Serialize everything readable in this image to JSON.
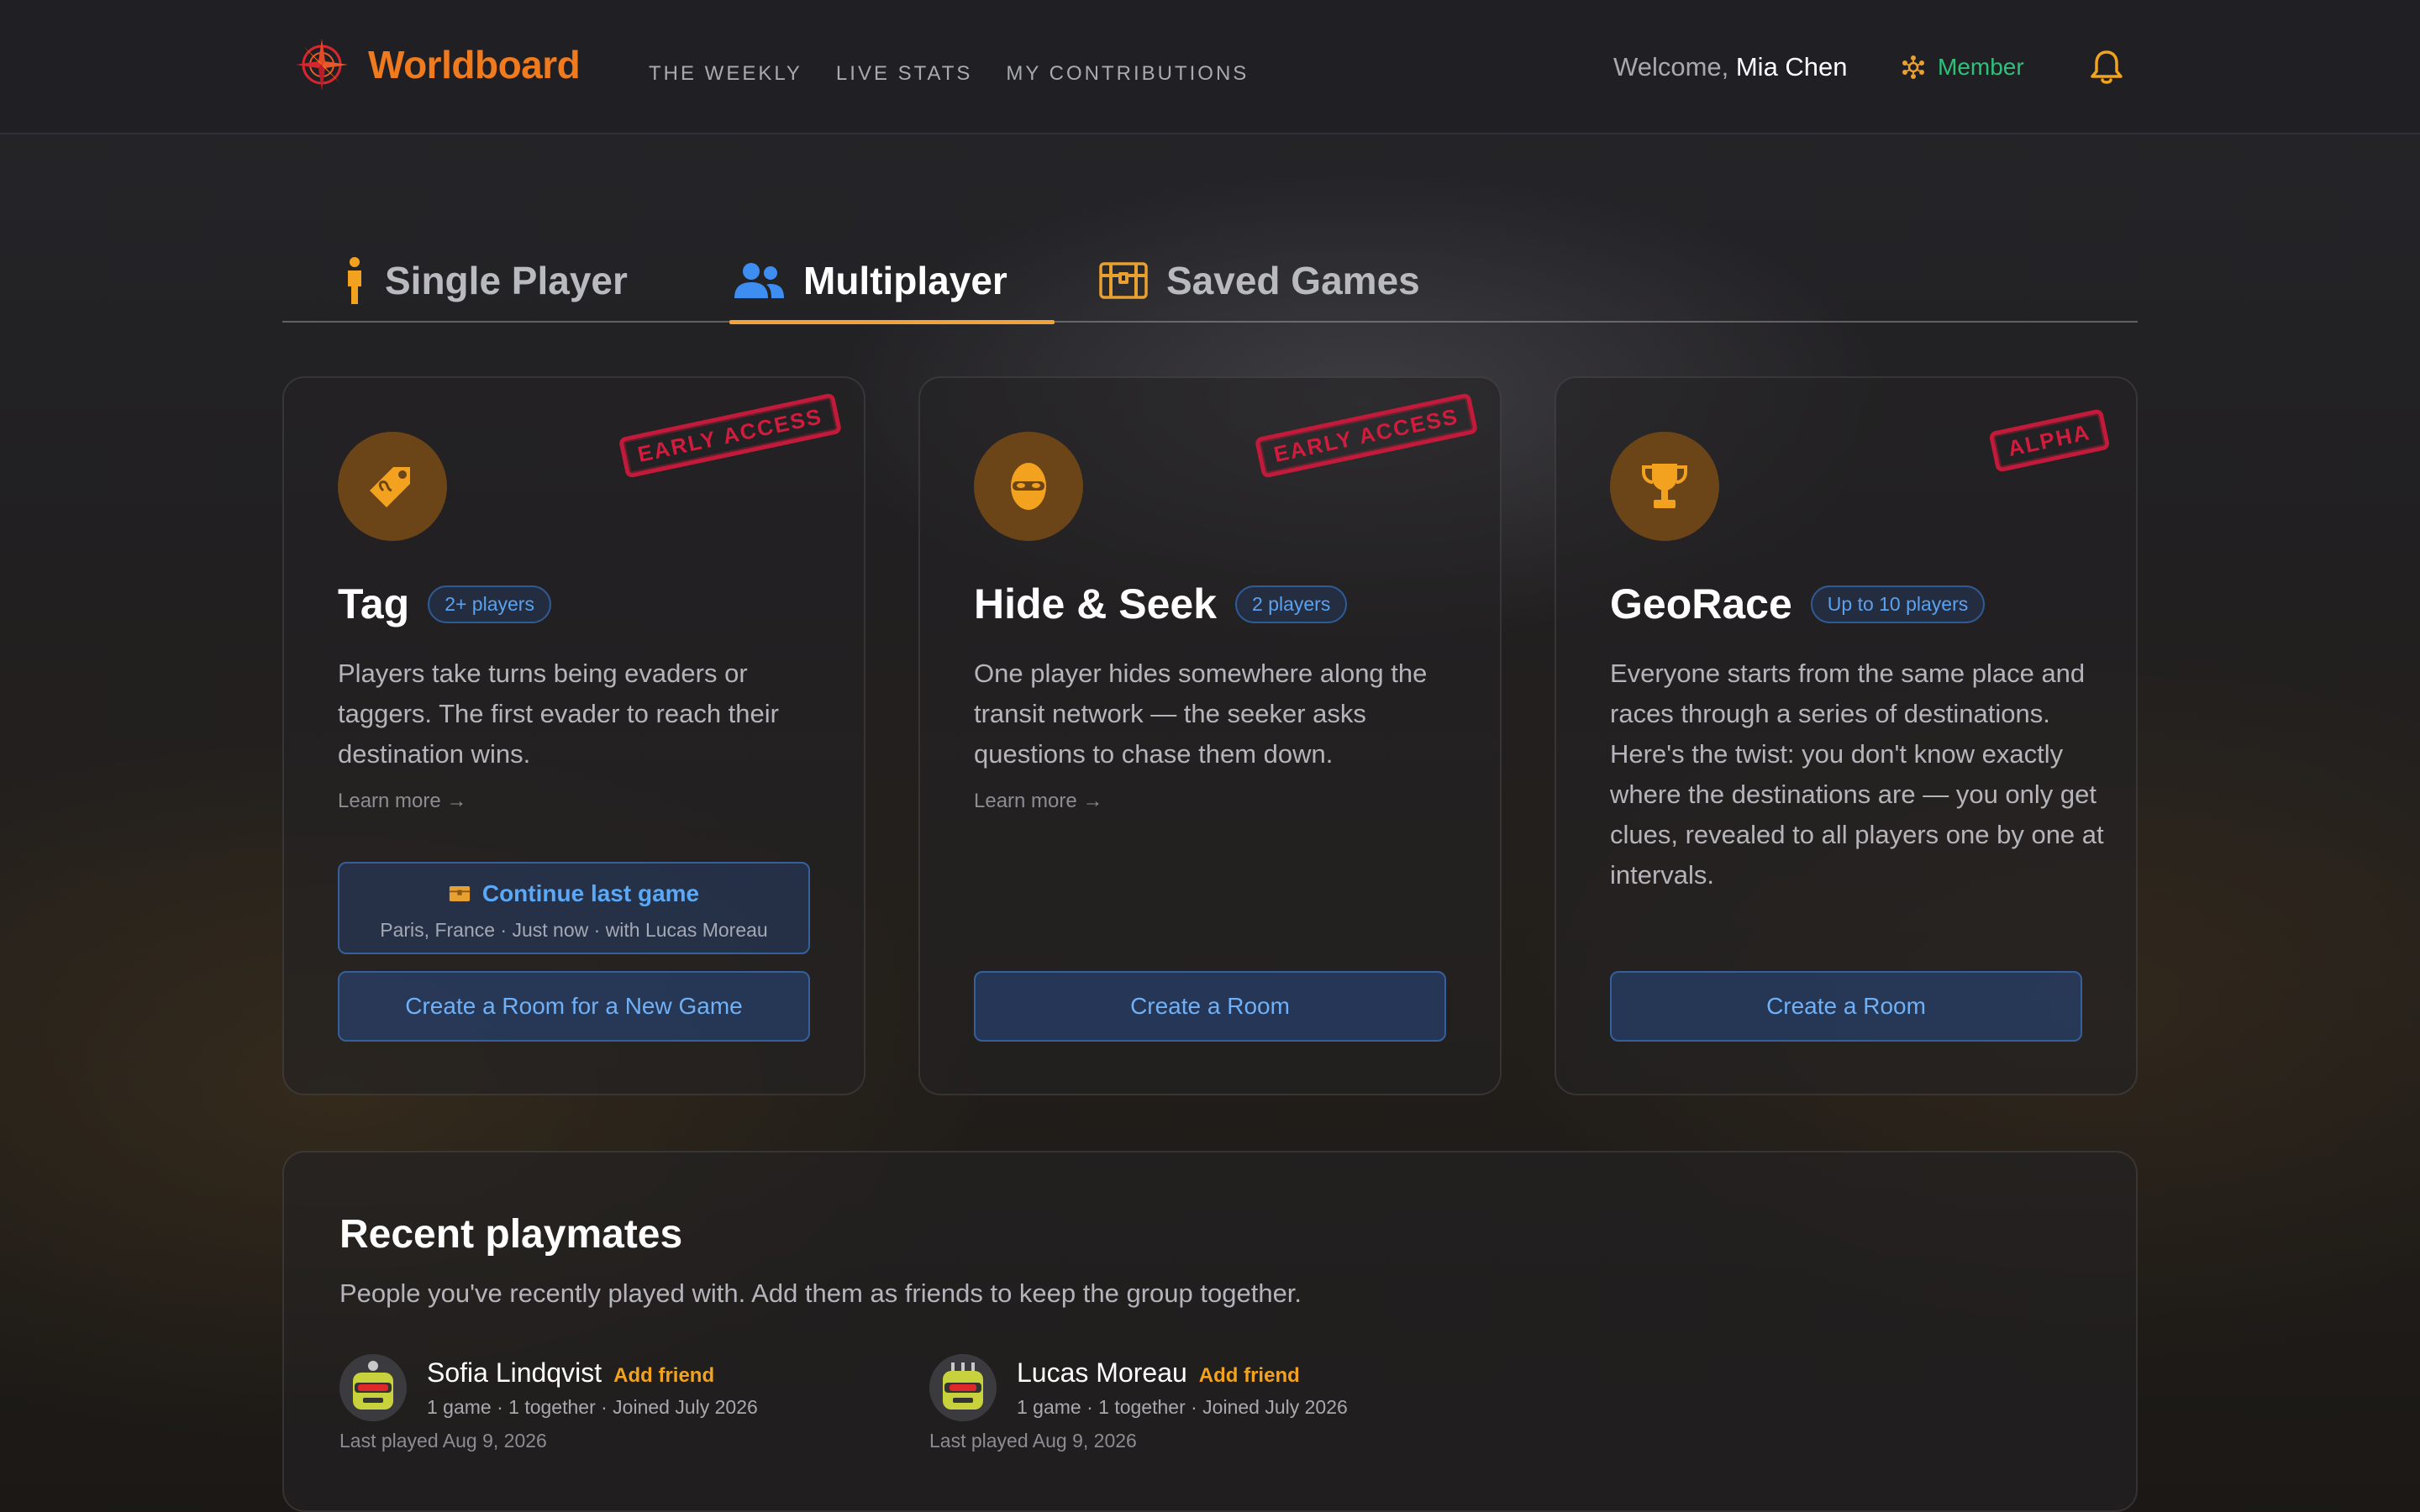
{
  "header": {
    "logo_text": "Worldboard",
    "nav": [
      "THE WEEKLY",
      "LIVE STATS",
      "MY CONTRIBUTIONS"
    ],
    "welcome_prefix": "Welcome, ",
    "user_name": "Mia Chen",
    "member_label": "Member"
  },
  "tabs": [
    {
      "label": "Single Player",
      "icon": "person-icon",
      "active": false
    },
    {
      "label": "Multiplayer",
      "icon": "users-icon",
      "active": true
    },
    {
      "label": "Saved Games",
      "icon": "treasure-chest-icon",
      "active": false
    }
  ],
  "cards": [
    {
      "icon": "tag-icon",
      "stamp": "EARLY ACCESS",
      "title": "Tag",
      "badge": "2+ players",
      "description": "Players take turns being evaders or taggers. The first evader to reach their destination wins.",
      "learn_more": "Learn more →",
      "continue_label": "Continue last game",
      "continue_sub": "Paris, France · Just now · with Lucas Moreau",
      "button": "Create a Room for a New Game"
    },
    {
      "icon": "ninja-icon",
      "stamp": "EARLY ACCESS",
      "title": "Hide & Seek",
      "badge": "2 players",
      "description": "One player hides somewhere along the transit network — the seeker asks questions to chase them down.",
      "learn_more": "Learn more →",
      "button": "Create a Room"
    },
    {
      "icon": "trophy-icon",
      "stamp": "ALPHA",
      "title": "GeoRace",
      "badge": "Up to 10 players",
      "description": "Everyone starts from the same place and races through a series of destinations. Here's the twist: you don't know exactly where the destinations are — you only get clues, revealed to all players one by one at intervals.",
      "button": "Create a Room"
    }
  ],
  "playmates": {
    "title": "Recent playmates",
    "subtitle": "People you've recently played with. Add them as friends to keep the group together.",
    "people": [
      {
        "name": "Sofia Lindqvist",
        "add": "Add friend",
        "stats": "1 game · 1 together · Joined July 2026",
        "last_played": "Last played Aug 9, 2026"
      },
      {
        "name": "Lucas Moreau",
        "add": "Add friend",
        "stats": "1 game · 1 together · Joined July 2026",
        "last_played": "Last played Aug 9, 2026"
      }
    ]
  },
  "colors": {
    "accent_orange": "#f07a1e",
    "tab_underline": "#f2a23a",
    "link_blue": "#5aa8f6",
    "member_green": "#2fc07a",
    "stamp_red": "#d21c3e"
  }
}
